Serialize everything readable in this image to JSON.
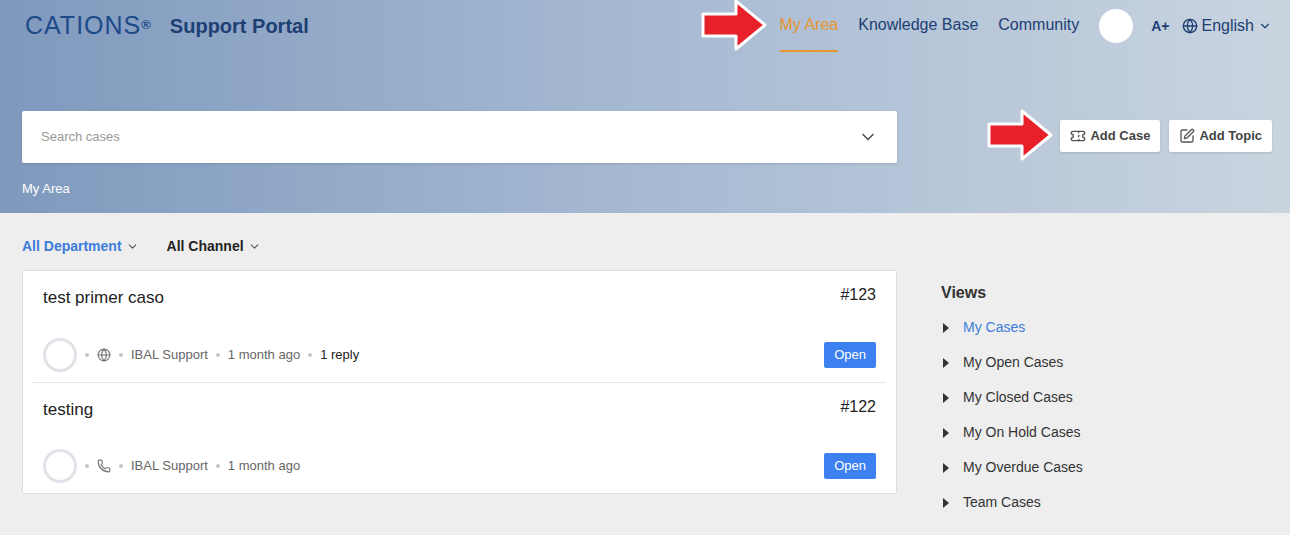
{
  "header": {
    "logo": {
      "text": "CATIONS",
      "mark": "®"
    },
    "title": "Support Portal",
    "nav": [
      {
        "label": "My Area",
        "selected": true,
        "marked": true
      },
      {
        "label": "Knowledge Base",
        "selected": false,
        "marked": false
      },
      {
        "label": "Community",
        "selected": false,
        "marked": false
      }
    ],
    "font_size_button": "A+",
    "language": "English"
  },
  "search": {
    "placeholder": "Search cases"
  },
  "actions": [
    {
      "label": "Add Case",
      "kind": "case",
      "marked": true
    },
    {
      "label": "Add Topic",
      "kind": "topic",
      "marked": false
    }
  ],
  "breadcrumb": "My Area",
  "filters": [
    {
      "label": "All Department",
      "selected": true
    },
    {
      "label": "All Channel",
      "selected": false
    }
  ],
  "cases": [
    {
      "title": "test primer caso",
      "number": "#123",
      "channel": "web",
      "agent": "IBAL Support",
      "time": "1 month ago",
      "replies": "1 reply",
      "status": "Open"
    },
    {
      "title": "testing",
      "number": "#122",
      "channel": "phone",
      "agent": "IBAL Support",
      "time": "1 month ago",
      "replies": "",
      "status": "Open"
    }
  ],
  "views": {
    "title": "Views",
    "items": [
      {
        "label": "My Cases",
        "selected": true
      },
      {
        "label": "My Open Cases",
        "selected": false
      },
      {
        "label": "My Closed Cases",
        "selected": false
      },
      {
        "label": "My On Hold Cases",
        "selected": false
      },
      {
        "label": "My Overdue Cases",
        "selected": false
      },
      {
        "label": "Team Cases",
        "selected": false
      }
    ]
  }
}
